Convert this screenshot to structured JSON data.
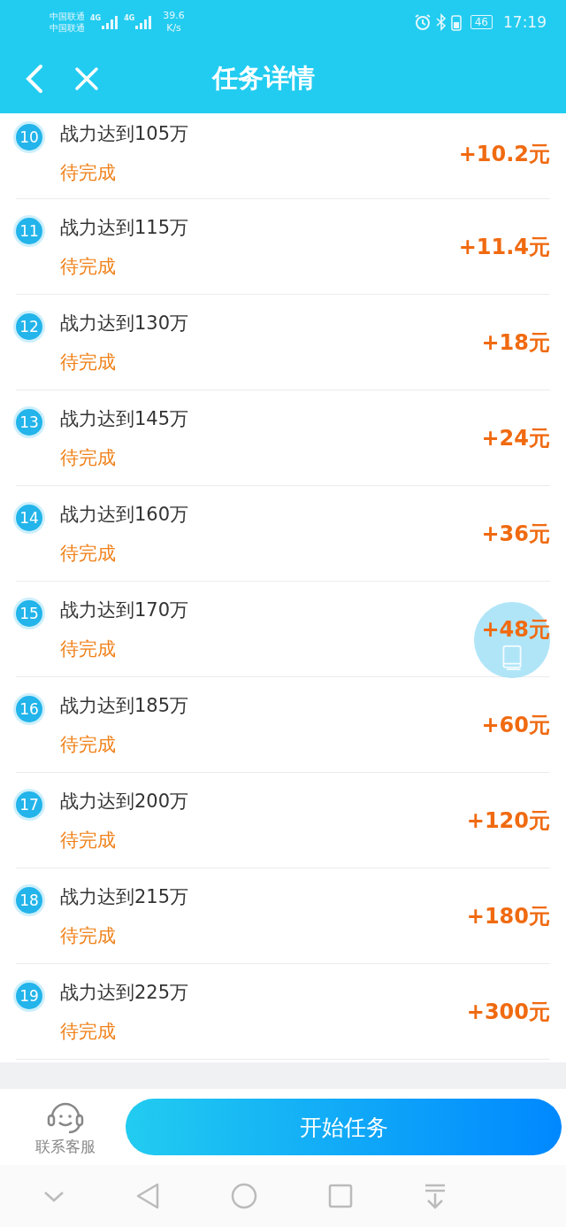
{
  "status_bar": {
    "carriers": [
      "中国联通",
      "中国联通"
    ],
    "network_labels": [
      "4G",
      "4G"
    ],
    "speed": [
      "39.6",
      "K/s"
    ],
    "battery": "46",
    "time": "17:19"
  },
  "header": {
    "title": "任务详情"
  },
  "tasks": [
    {
      "number": "10",
      "title": "战力达到105万",
      "status": "待完成",
      "reward": "+10.2元"
    },
    {
      "number": "11",
      "title": "战力达到115万",
      "status": "待完成",
      "reward": "+11.4元"
    },
    {
      "number": "12",
      "title": "战力达到130万",
      "status": "待完成",
      "reward": "+18元"
    },
    {
      "number": "13",
      "title": "战力达到145万",
      "status": "待完成",
      "reward": "+24元"
    },
    {
      "number": "14",
      "title": "战力达到160万",
      "status": "待完成",
      "reward": "+36元"
    },
    {
      "number": "15",
      "title": "战力达到170万",
      "status": "待完成",
      "reward": "+48元"
    },
    {
      "number": "16",
      "title": "战力达到185万",
      "status": "待完成",
      "reward": "+60元"
    },
    {
      "number": "17",
      "title": "战力达到200万",
      "status": "待完成",
      "reward": "+120元"
    },
    {
      "number": "18",
      "title": "战力达到215万",
      "status": "待完成",
      "reward": "+180元"
    },
    {
      "number": "19",
      "title": "战力达到225万",
      "status": "待完成",
      "reward": "+300元"
    }
  ],
  "bottom_bar": {
    "service_label": "联系客服",
    "start_button": "开始任务"
  }
}
